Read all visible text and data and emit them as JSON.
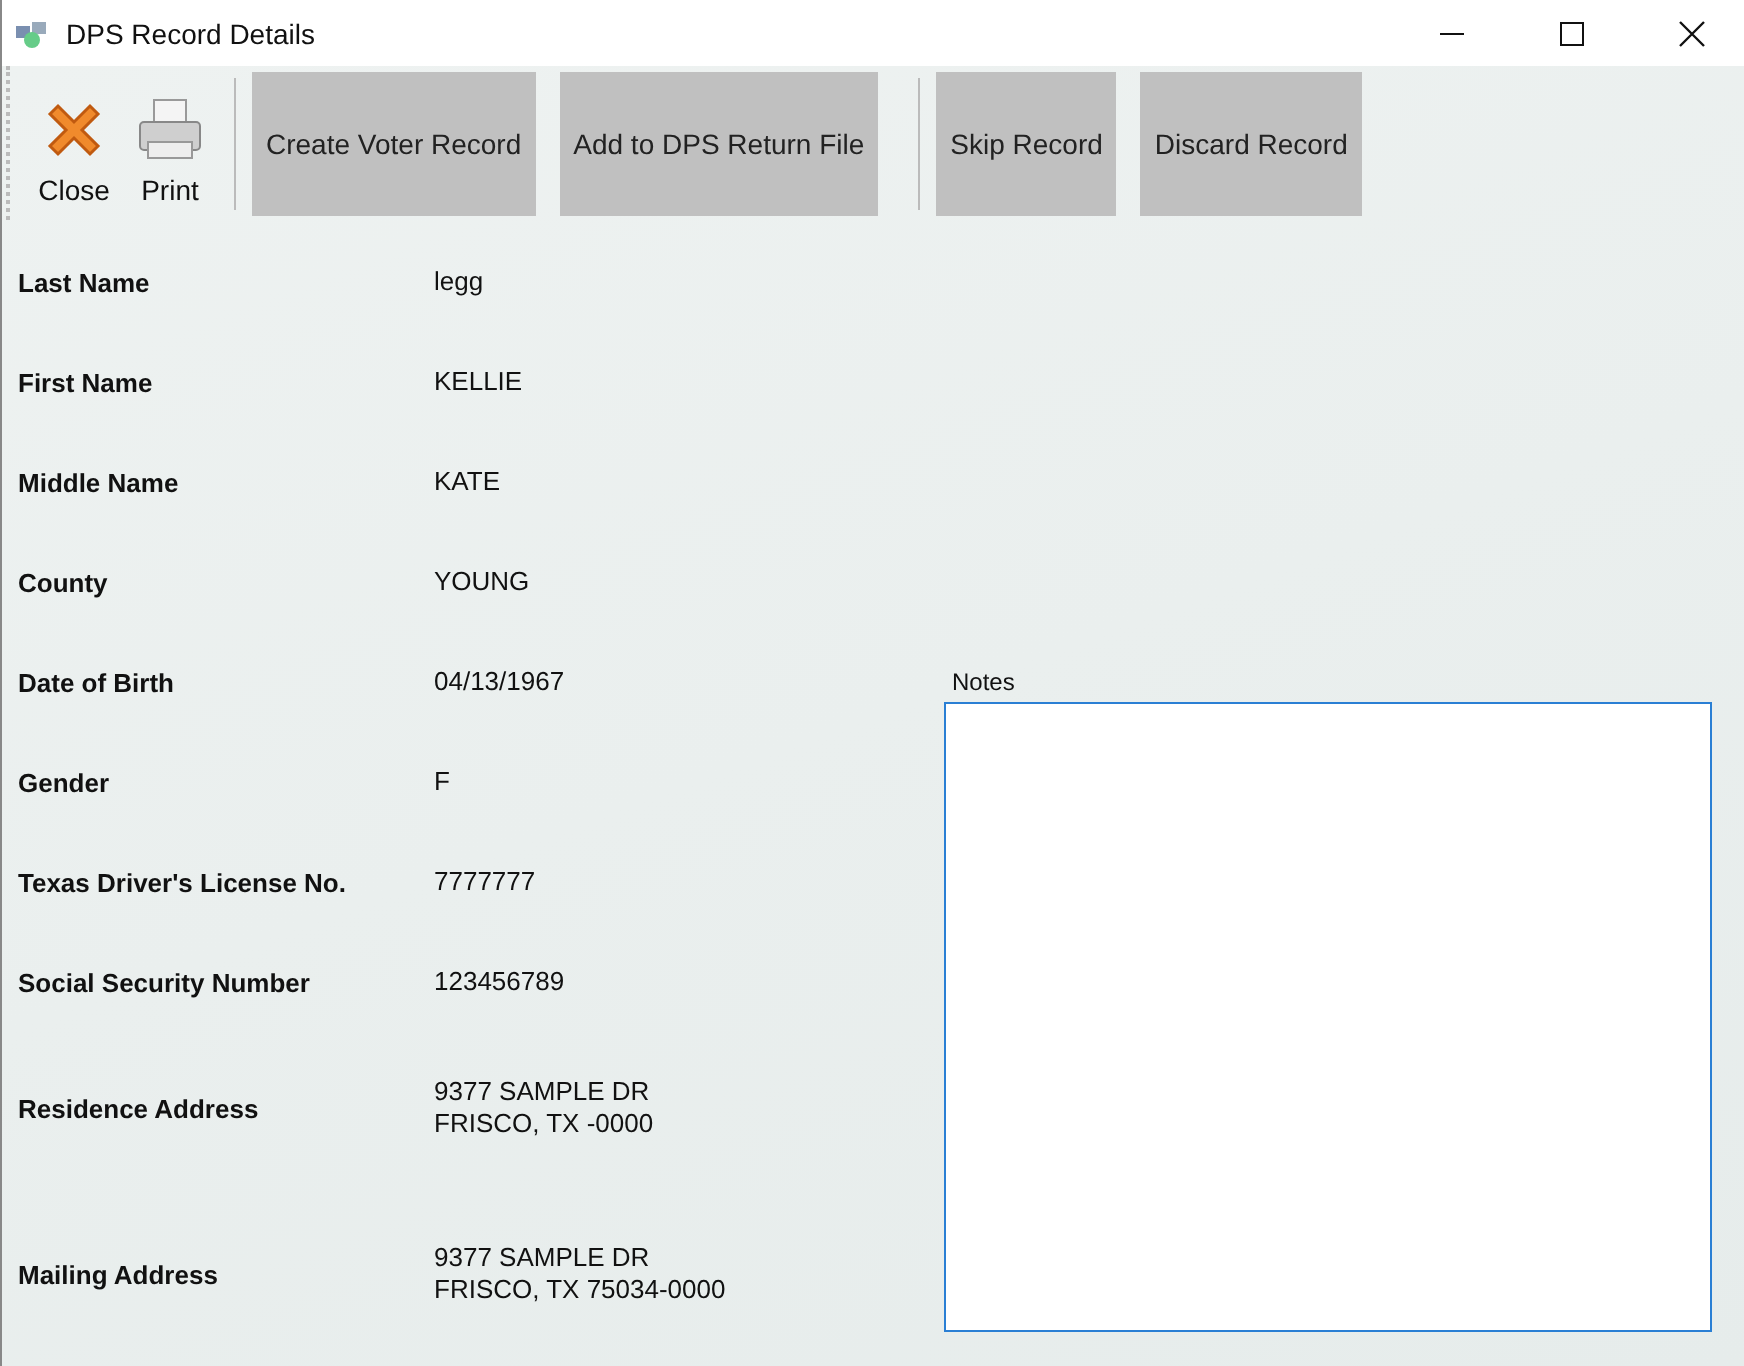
{
  "window": {
    "title": "DPS Record Details"
  },
  "toolbar": {
    "tools": [
      {
        "label": "Close",
        "kind": "close"
      },
      {
        "label": "Print",
        "kind": "print"
      }
    ],
    "button_groups": [
      [
        "Create Voter Record",
        "Add to DPS Return File"
      ],
      [
        "Skip Record",
        "Discard Record"
      ]
    ]
  },
  "fields": [
    {
      "label": "Last Name",
      "value": [
        "legg"
      ]
    },
    {
      "label": "First Name",
      "value": [
        "KELLIE"
      ]
    },
    {
      "label": "Middle Name",
      "value": [
        "KATE"
      ]
    },
    {
      "label": "County",
      "value": [
        "YOUNG"
      ]
    },
    {
      "label": "Date of Birth",
      "value": [
        "04/13/1967"
      ]
    },
    {
      "label": "Gender",
      "value": [
        "F"
      ]
    },
    {
      "label": "Texas Driver's License No.",
      "value": [
        "7777777"
      ]
    },
    {
      "label": "Social Security Number",
      "value": [
        "123456789"
      ]
    },
    {
      "label": "Residence Address",
      "value": [
        "9377 SAMPLE DR",
        "FRISCO, TX -0000"
      ]
    },
    {
      "label": "Mailing Address",
      "value": [
        "9377 SAMPLE DR",
        "FRISCO, TX 75034-0000"
      ]
    }
  ],
  "notes": {
    "label": "Notes"
  }
}
